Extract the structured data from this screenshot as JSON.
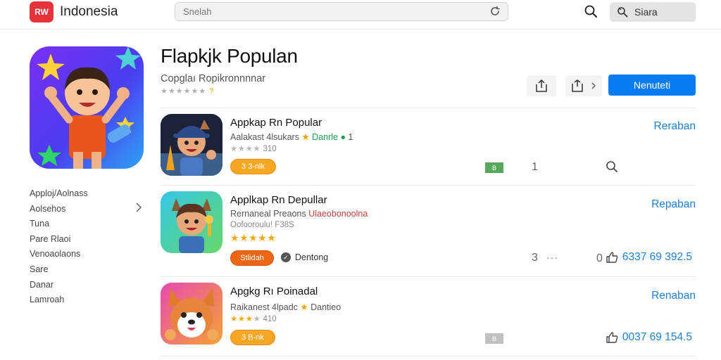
{
  "header": {
    "logo_text": "RW",
    "brand": "Indonesia",
    "search_placeholder": "Snelah",
    "share_label": "Siara",
    "icons": [
      "refresh-icon",
      "search-icon",
      "share-icon"
    ]
  },
  "hero": {
    "title": "Flapkjk Populan",
    "subtitle": "Copglaı Ropikronnnnar",
    "stars": "★★★★★★",
    "stars_end": "?",
    "primary_button": "Nenuteti",
    "colors": {
      "accent": "#0a7cf2",
      "brand": "#e8323a"
    }
  },
  "sidebar": {
    "items": [
      {
        "label": "Apploj/Aolnass"
      },
      {
        "label": "Aolsehos"
      },
      {
        "label": "Tuna"
      },
      {
        "label": "Pare Rlaoi"
      },
      {
        "label": "Venoaolaons"
      },
      {
        "label": "Sare"
      },
      {
        "label": "Danar"
      },
      {
        "label": "Lamroah"
      }
    ]
  },
  "apps": [
    {
      "name": "Appkap Rn Popular",
      "sub_a": "Aalakast 4lsukars",
      "sub_q": "★",
      "sub_b": "Danrle",
      "sub_c": "1",
      "stars_filled": "★★★★",
      "stars_empty": "",
      "rating_text": "310",
      "pill": "3 3-nlk",
      "badge": "B",
      "num": "1",
      "link": "Reraban"
    },
    {
      "name": "Applkap Rn Depullar",
      "sub_a": "Rernaneal Preaons",
      "sub_b": "Ulaeobonoolna",
      "stars_top": "Oofooroulu! F38S",
      "stars_filled": "★★★★★",
      "stars_empty": "",
      "rating_text": "",
      "pill": "Stlidah",
      "verified": "Dentong",
      "num": "3",
      "dots": "···",
      "count": "0",
      "link": "Repaban",
      "price": "6337 69 392.5"
    },
    {
      "name": "Apgkg Rı Poinadal",
      "sub_a": "Raikanest 4lpadc",
      "sub_q": "★",
      "sub_b": "Dantieo",
      "stars_filled": "★★★",
      "stars_empty": "★",
      "rating_text": "410",
      "pill": "3 B-nk",
      "badge": "B",
      "link": "Renaban",
      "price": "0037 69 154.5"
    }
  ]
}
